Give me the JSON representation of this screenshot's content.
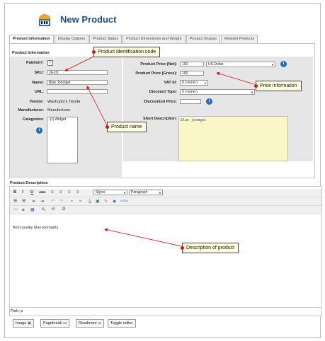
{
  "header": {
    "title": "New Product"
  },
  "tabs": [
    {
      "label": "Product Information"
    },
    {
      "label": "Display Options"
    },
    {
      "label": "Product Status"
    },
    {
      "label": "Product Dimensions and Weight"
    },
    {
      "label": "Product Images"
    },
    {
      "label": "Related Products"
    }
  ],
  "product_info": {
    "section_title": "Product Information",
    "publish_label": "Publish?:",
    "publish_checked": "✓",
    "sku_label": "SKU:",
    "sku_value": "JG-01",
    "name_label": "Name:",
    "name_value": "Blue Joomget",
    "url_label": "URL:",
    "url_value": "",
    "vendor_label": "Vendor:",
    "vendor_value": "Washupto's Tienda",
    "manufacturer_label": "Manufacturer:",
    "manufacturer_value": "Manufacturer",
    "categories_label": "Categories:",
    "categories_value": "-|1| Widget"
  },
  "pricing": {
    "net_label": "Product Price (Net):",
    "net_value": "100",
    "currency": "US Dollar",
    "gross_label": "Product Price (Gross):",
    "gross_value": "100",
    "vat_label": "VAT Id:",
    "vat_value": "0 (-none-)",
    "discount_type_label": "Discount Type:",
    "discount_type_value": "0 (-none-)",
    "discounted_price_label": "Discounted Price:",
    "discounted_price_value": "",
    "short_desc_label": "Short Description:",
    "short_desc_value": "Blue joomget"
  },
  "callouts": {
    "product_id": "Product identification code",
    "price_info": "Price information",
    "product_name": "Product name",
    "description": "Description of product"
  },
  "editor": {
    "label": "Product Description:",
    "bold": "B",
    "italic": "I",
    "underline": "U",
    "strike": "ABC",
    "styles": "Styles",
    "format": "Paragraph",
    "content": "Best quality blue joomgets",
    "path": "Path: p"
  },
  "bottom_buttons": [
    {
      "label": "Image"
    },
    {
      "label": "Pagebreak"
    },
    {
      "label": "Readmore"
    },
    {
      "label": "Toggle editor"
    }
  ],
  "colors": {
    "title": "#1d4a8a",
    "info_icon": "#1e6fc8",
    "callout_bg": "#ffffe0",
    "arrow": "#e01010",
    "short_desc_bg": "#fbf6c5"
  },
  "icons": [
    "product-box-icon",
    "info-icon"
  ]
}
